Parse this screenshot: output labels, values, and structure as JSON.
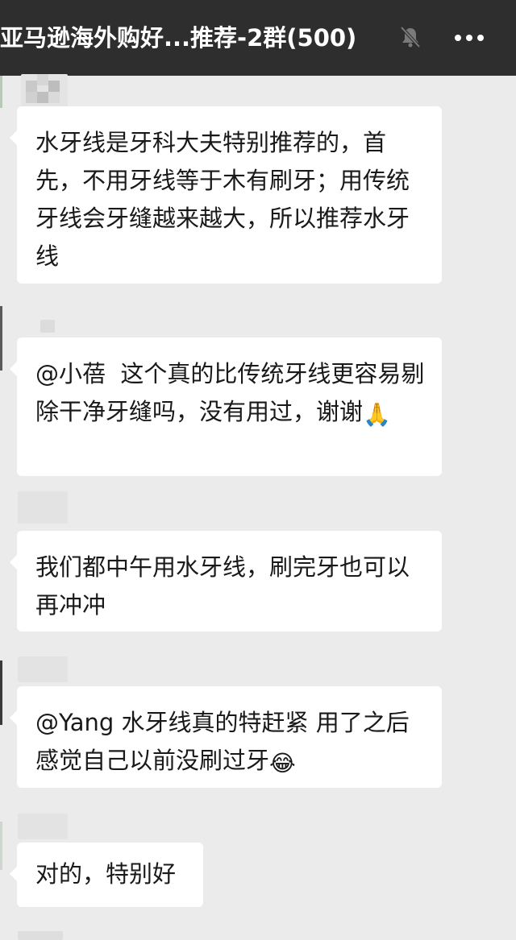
{
  "header": {
    "title": "亚马逊海外购好...推荐-2群(500)",
    "mute_icon": "muted-bell-icon",
    "more_icon": "more-dots-icon"
  },
  "messages": [
    {
      "text": "水牙线是牙科大夫特别推荐的，首先，不用牙线等于木有刷牙；用传统牙线会牙缝越来越大，所以推荐水牙线"
    },
    {
      "text": "@小蓓  这个真的比传统牙线更容易剔除干净牙缝吗，没有用过，谢谢",
      "emoji": "🙏",
      "emoji_name": "praying-hands-icon"
    },
    {
      "text": "我们都中午用水牙线，刷完牙也可以再冲冲"
    },
    {
      "text": "@Yang 水牙线真的特赶紧 用了之后感觉自己以前没刷过牙",
      "emoji": "😂",
      "emoji_name": "laughing-tears-icon"
    },
    {
      "text": "对的，特别好"
    }
  ],
  "colors": {
    "header_bg": "#2e2e2e",
    "chat_bg": "#ebebeb",
    "bubble_bg": "#ffffff",
    "text": "#191919"
  }
}
